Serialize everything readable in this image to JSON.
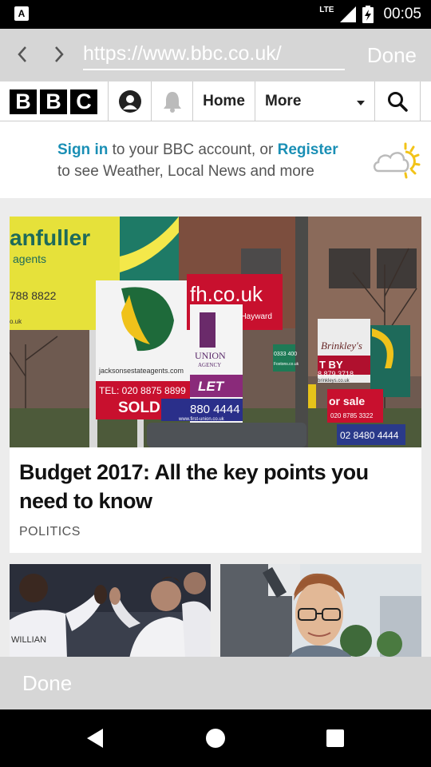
{
  "status_bar": {
    "network": "LTE",
    "time": "00:05",
    "notification_icon": "A"
  },
  "browser": {
    "url": "https://www.bbc.co.uk/",
    "done_top": "Done",
    "done_bottom": "Done"
  },
  "bbc_nav": {
    "logo_letters": [
      "B",
      "B",
      "C"
    ],
    "home": "Home",
    "more": "More"
  },
  "signin": {
    "sign_in": "Sign in",
    "text1": " to your BBC account, or ",
    "register": "Register",
    "text2": "to see Weather, Local News and more"
  },
  "top_story": {
    "headline": "Budget 2017: All the key points you need to know",
    "section": "POLITICS",
    "image_signs": {
      "sign1_name": "anfuller",
      "sign1_sub": "agents",
      "sign1_phone": "788 8822",
      "sign1_web": "o.uk",
      "sign2_web": "jacksonsestateagents.com",
      "sign2_tel": "TEL: 020 8875 8899",
      "sign2_sold": "SOLD",
      "sign3_web": "fh.co.uk",
      "sign3_sub": "& Hayward",
      "sign4_name": "UNION",
      "sign4_sub": "AGENCY",
      "sign4_let": "LET",
      "sign4_phone": "880 4444",
      "sign4_web": "www.first-union.co.uk",
      "sign5_name": "Brinkley's",
      "sign5_status": "T BY",
      "sign5_phone": "8 879 3718",
      "sign5_web": "brinkleys.co.uk",
      "sign6_status": "or sale",
      "sign6_phone": "020 8785 3322",
      "sign7_phone": "02 8480 4444",
      "sign8_phone": "0333 400",
      "sign8_web": "Foxtons.co.uk"
    }
  },
  "thumbnails": {
    "left_jersey": "WILLIAN"
  },
  "colors": {
    "bbc_black": "#000000",
    "link_blue": "#1a8fb5",
    "browser_bar": "#d6d6d6"
  },
  "icons": {
    "back": "chevron-left-icon",
    "forward": "chevron-right-icon",
    "account": "account-icon",
    "bell": "bell-icon",
    "search": "search-icon",
    "weather": "partly-sunny-icon"
  }
}
